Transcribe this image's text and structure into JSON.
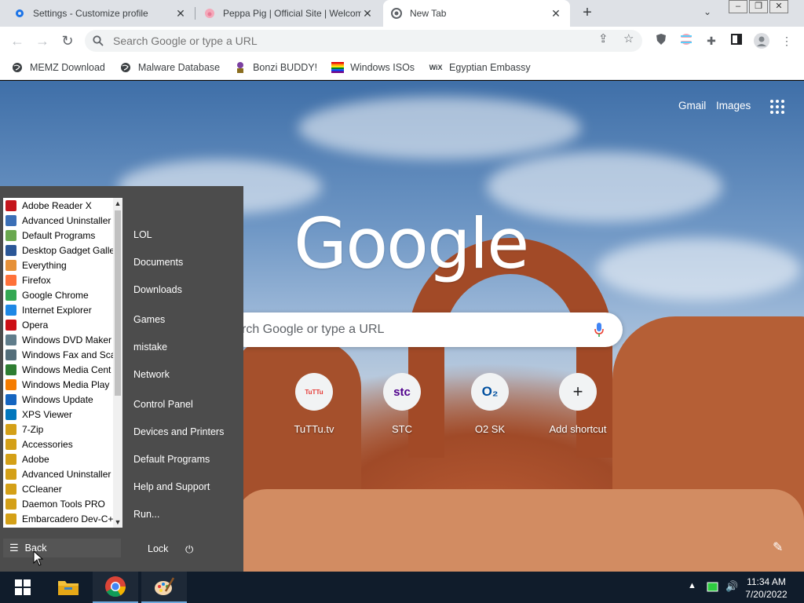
{
  "tabs": [
    {
      "title": "Settings - Customize profile",
      "icon": "gear-icon"
    },
    {
      "title": "Peppa Pig | Official Site | Welcom",
      "icon": "peppa-icon"
    },
    {
      "title": "New Tab",
      "icon": "chrome-icon"
    }
  ],
  "omnibox": {
    "placeholder": "Search Google or type a URL"
  },
  "bookmarks": [
    {
      "label": "MEMZ Download",
      "icon": "globe-icon"
    },
    {
      "label": "Malware Database",
      "icon": "globe-icon"
    },
    {
      "label": "Bonzi BUDDY!",
      "icon": "bonzi-icon"
    },
    {
      "label": "Windows ISOs",
      "icon": "rainbow-flag-icon"
    },
    {
      "label": "Egyptian Embassy",
      "icon": "wix-icon"
    }
  ],
  "wix_text": "WiX",
  "ntp": {
    "gmail": "Gmail",
    "images": "Images",
    "logo": "Google",
    "search_placeholder": "rch Google or type a URL",
    "shortcuts": [
      {
        "label": "TuTTu.tv",
        "icon_text": "TuTTu"
      },
      {
        "label": "STC",
        "icon_text": "stc"
      },
      {
        "label": "O2 SK",
        "icon_text": "O₂"
      },
      {
        "label": "Add shortcut",
        "icon_text": "+"
      }
    ]
  },
  "start_menu": {
    "programs": [
      {
        "label": "Adobe Reader X",
        "color": "#c4161c"
      },
      {
        "label": "Advanced Uninstaller",
        "color": "#3b6fb6"
      },
      {
        "label": "Default Programs",
        "color": "#6aa84f"
      },
      {
        "label": "Desktop Gadget Galle",
        "color": "#2b5797"
      },
      {
        "label": "Everything",
        "color": "#e69138"
      },
      {
        "label": "Firefox",
        "color": "#ff7139"
      },
      {
        "label": "Google Chrome",
        "color": "#34a853"
      },
      {
        "label": "Internet Explorer",
        "color": "#1e88e5"
      },
      {
        "label": "Opera",
        "color": "#cc0f16"
      },
      {
        "label": "Windows DVD Maker",
        "color": "#607d8b"
      },
      {
        "label": "Windows Fax and Sca",
        "color": "#546e7a"
      },
      {
        "label": "Windows Media Cent",
        "color": "#2e7d32"
      },
      {
        "label": "Windows Media Play",
        "color": "#f57c00"
      },
      {
        "label": "Windows Update",
        "color": "#1565c0"
      },
      {
        "label": "XPS Viewer",
        "color": "#0277bd"
      },
      {
        "label": "7-Zip",
        "color": "#d4a017"
      },
      {
        "label": "Accessories",
        "color": "#d4a017"
      },
      {
        "label": "Adobe",
        "color": "#d4a017"
      },
      {
        "label": "Advanced Uninstaller",
        "color": "#d4a017"
      },
      {
        "label": "CCleaner",
        "color": "#d4a017"
      },
      {
        "label": "Daemon Tools PRO",
        "color": "#d4a017"
      },
      {
        "label": "Embarcadero Dev-C+",
        "color": "#d4a017"
      }
    ],
    "places": [
      "LOL",
      "Documents",
      "Downloads",
      "Games",
      "mistake",
      "Network",
      "Control Panel",
      "Devices and Printers",
      "Default Programs",
      "Help and Support",
      "Run..."
    ],
    "back": "Back",
    "lock": "Lock"
  },
  "taskbar": {
    "time": "11:34 AM",
    "date": "7/20/2022"
  }
}
